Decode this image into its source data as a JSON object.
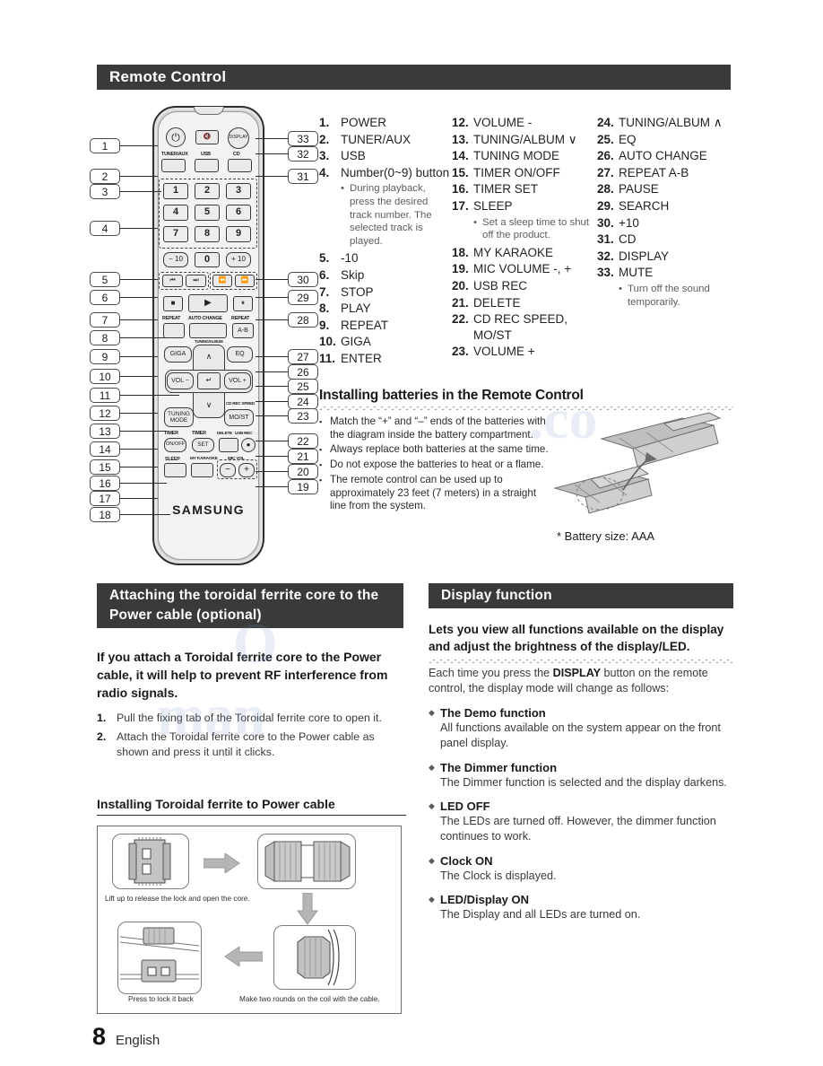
{
  "header": {
    "title": "Remote Control"
  },
  "functions": {
    "column1": [
      {
        "num": "1.",
        "label": "POWER"
      },
      {
        "num": "2.",
        "label": "TUNER/AUX"
      },
      {
        "num": "3.",
        "label": "USB"
      },
      {
        "num": "4.",
        "label": "Number(0~9) button",
        "note": "During playback, press the desired track number. The selected track is played."
      },
      {
        "num": "5.",
        "label": "-10"
      },
      {
        "num": "6.",
        "label": "Skip"
      },
      {
        "num": "7.",
        "label": "STOP"
      },
      {
        "num": "8.",
        "label": "PLAY"
      },
      {
        "num": "9.",
        "label": "REPEAT"
      },
      {
        "num": "10.",
        "label": "GIGA"
      },
      {
        "num": "11.",
        "label": "ENTER"
      }
    ],
    "column2": [
      {
        "num": "12.",
        "label": "VOLUME -"
      },
      {
        "num": "13.",
        "label": "TUNING/ALBUM ∨"
      },
      {
        "num": "14.",
        "label": "TUNING MODE"
      },
      {
        "num": "15.",
        "label": "TIMER ON/OFF"
      },
      {
        "num": "16.",
        "label": "TIMER SET"
      },
      {
        "num": "17.",
        "label": "SLEEP",
        "note": "Set a sleep time to shut off the product."
      },
      {
        "num": "18.",
        "label": "MY KARAOKE"
      },
      {
        "num": "19.",
        "label": "MIC VOLUME -, +"
      },
      {
        "num": "20.",
        "label": "USB REC"
      },
      {
        "num": "21.",
        "label": "DELETE"
      },
      {
        "num": "22.",
        "label": "CD REC SPEED, MO/ST"
      },
      {
        "num": "23.",
        "label": "VOLUME +"
      }
    ],
    "column3": [
      {
        "num": "24.",
        "label": "TUNING/ALBUM ∧"
      },
      {
        "num": "25.",
        "label": "EQ"
      },
      {
        "num": "26.",
        "label": "AUTO CHANGE"
      },
      {
        "num": "27.",
        "label": "REPEAT A-B"
      },
      {
        "num": "28.",
        "label": "PAUSE"
      },
      {
        "num": "29.",
        "label": "SEARCH"
      },
      {
        "num": "30.",
        "label": "+10"
      },
      {
        "num": "31.",
        "label": "CD"
      },
      {
        "num": "32.",
        "label": "DISPLAY"
      },
      {
        "num": "33.",
        "label": "MUTE",
        "note": "Turn off the sound temporarily."
      }
    ]
  },
  "remote": {
    "callouts_left": [
      "1",
      "2",
      "3",
      "4",
      "5",
      "6",
      "7",
      "8",
      "9",
      "10",
      "11",
      "12",
      "13",
      "14",
      "15",
      "16",
      "17",
      "18"
    ],
    "callouts_right": [
      "33",
      "32",
      "31",
      "30",
      "29",
      "28",
      "27",
      "26",
      "25",
      "24",
      "23",
      "22",
      "21",
      "20",
      "19"
    ],
    "labels": {
      "tuner_aux": "TUNER/AUX",
      "usb": "USB",
      "cd": "CD",
      "display": "DISPLAY",
      "repeat_left": "REPEAT",
      "auto_change": "AUTO CHANGE",
      "repeat_right": "REPEAT",
      "ab": "A-B",
      "giga": "GIGA",
      "eq": "EQ",
      "vol_minus": "VOL −",
      "vol_plus": "VOL +",
      "tuning_mode": "TUNING MODE",
      "mo_st": "MO/ST",
      "cd_rec_speed": "CD REC SPEED",
      "timer_onoff_small": "TIMER",
      "timer_set_small": "TIMER",
      "on_off": "ON/OFF",
      "set": "SET",
      "delete": "DELETE",
      "usb_rec": "USB REC",
      "sleep": "SLEEP",
      "my_karaoke": "MY KARAOKE",
      "mic_vol": "MIC VOL",
      "minus_ten": "− 10",
      "plus_ten": "+ 10",
      "tuning_album": "TUNING/ALBUM",
      "brand": "SAMSUNG"
    },
    "numbers": [
      "1",
      "2",
      "3",
      "4",
      "5",
      "6",
      "7",
      "8",
      "9",
      "0"
    ]
  },
  "battery_section": {
    "title": "Installing batteries in the Remote Control",
    "bullets": [
      "Match the “+” and “–” ends of the batteries with the diagram inside the battery compartment.",
      "Always replace both batteries at the same time.",
      "Do not expose the batteries to heat or a flame.",
      "The remote control can be used up to approximately 23 feet (7 meters) in a straight line from the system."
    ],
    "caption": "* Battery size: AAA"
  },
  "ferrite_section": {
    "banner": "Attaching the toroidal ferrite core to the Power cable (optional)",
    "intro": "If you attach a Toroidal ferrite core to the Power cable, it will help to prevent RF interference from radio signals.",
    "steps": [
      {
        "num": "1.",
        "text": "Pull the fixing tab of the Toroidal ferrite core to open it."
      },
      {
        "num": "2.",
        "text": "Attach the Toroidal ferrite core to the Power cable as shown and press it until it clicks."
      }
    ],
    "subhead": "Installing Toroidal ferrite to Power cable",
    "figure_captions": {
      "step1": "Lift up to release the lock and open the core.",
      "step2": "Make two rounds on the coil with the cable.",
      "step3": "Press to lock it back"
    }
  },
  "display_section": {
    "banner": "Display function",
    "intro": "Lets you view all functions available on the display and adjust the brightness of the display/LED.",
    "body_pre": "Each time you press the ",
    "body_bold": "DISPLAY",
    "body_post": " button on the remote control, the display mode will change as follows:",
    "modes": [
      {
        "title": "The Demo function",
        "desc": "All functions available on the system appear on the front panel display."
      },
      {
        "title": "The Dimmer function",
        "desc": "The Dimmer function is selected and the display darkens."
      },
      {
        "title": "LED OFF",
        "desc": "The LEDs are turned off. However, the dimmer function continues to work."
      },
      {
        "title": "Clock ON",
        "desc": "The Clock is displayed."
      },
      {
        "title": "LED/Display ON",
        "desc": "The Display and all LEDs are turned on."
      }
    ]
  },
  "footer": {
    "page_number": "8",
    "language": "English"
  },
  "colors": {
    "banner_bg": "#3a3a3a",
    "banner_text": "#ffffff",
    "body_text": "#231f20"
  }
}
